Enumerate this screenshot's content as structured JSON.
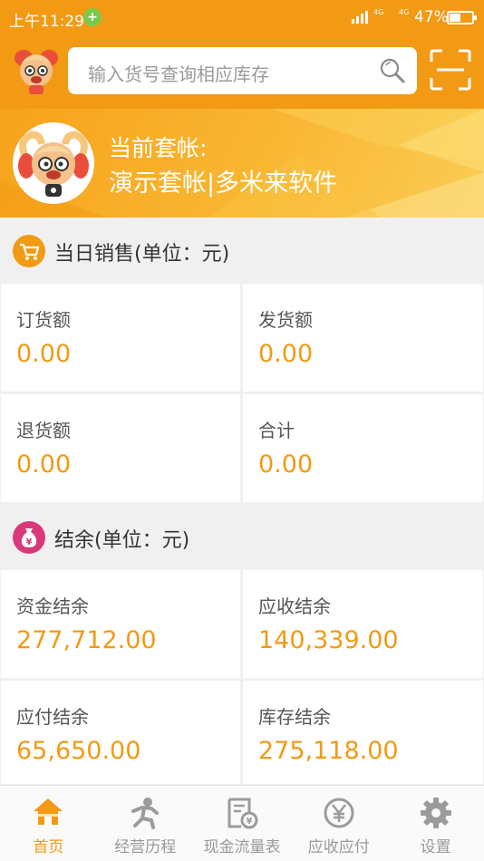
{
  "status_bar": {
    "time": "上午11:29",
    "notification_badge": "+",
    "network_1": "4G",
    "network_2": "4G",
    "battery": "47%"
  },
  "search": {
    "placeholder": "输入货号查询相应库存",
    "search_icon": "magnifier-icon",
    "scan_icon": "scan-icon"
  },
  "account": {
    "label": "当前套帐:",
    "name": "演示套帐|多米来软件"
  },
  "daily_sales": {
    "title": "当日销售(单位：元)",
    "icon": "cart-icon",
    "icon_color": "#f29a14",
    "cards": [
      {
        "label": "订货额",
        "value": "0.00"
      },
      {
        "label": "发货额",
        "value": "0.00"
      },
      {
        "label": "退货额",
        "value": "0.00"
      },
      {
        "label": "合计",
        "value": "0.00"
      }
    ]
  },
  "balance": {
    "title": "结余(单位：元)",
    "icon": "money-bag-icon",
    "icon_color": "#d9397b",
    "cards": [
      {
        "label": "资金结余",
        "value": "277,712.00"
      },
      {
        "label": "应收结余",
        "value": "140,339.00"
      },
      {
        "label": "应付结余",
        "value": "65,650.00"
      },
      {
        "label": "库存结余",
        "value": "275,118.00"
      }
    ]
  },
  "nav": {
    "items": [
      {
        "label": "首页",
        "icon": "home-icon",
        "active": true
      },
      {
        "label": "经营历程",
        "icon": "runner-icon",
        "active": false
      },
      {
        "label": "现金流量表",
        "icon": "cashflow-icon",
        "active": false
      },
      {
        "label": "应收应付",
        "icon": "yen-icon",
        "active": false
      },
      {
        "label": "设置",
        "icon": "gear-icon",
        "active": false
      }
    ]
  },
  "colors": {
    "accent": "#f29a14",
    "value_text": "#f29a14",
    "nav_inactive": "#999999"
  }
}
